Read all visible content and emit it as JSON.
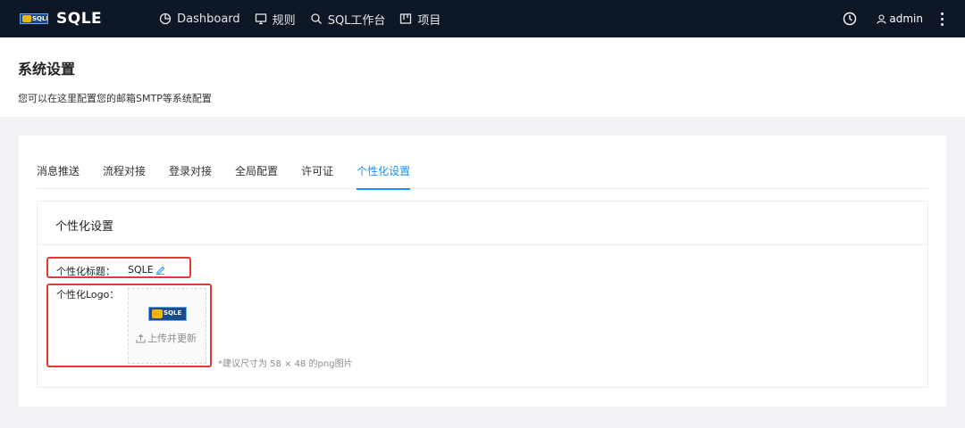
{
  "app": {
    "name": "SQLE",
    "logo_text": "SQLE"
  },
  "nav": [
    {
      "label": "Dashboard",
      "icon": "dashboard-icon"
    },
    {
      "label": "规则",
      "icon": "monitor-icon"
    },
    {
      "label": "SQL工作台",
      "icon": "search-icon"
    },
    {
      "label": "项目",
      "icon": "project-icon"
    }
  ],
  "user": {
    "name": "admin"
  },
  "page": {
    "title": "系统设置",
    "description": "您可以在这里配置您的邮箱SMTP等系统配置"
  },
  "tabs": [
    {
      "label": "消息推送",
      "active": false
    },
    {
      "label": "流程对接",
      "active": false
    },
    {
      "label": "登录对接",
      "active": false
    },
    {
      "label": "全局配置",
      "active": false
    },
    {
      "label": "许可证",
      "active": false
    },
    {
      "label": "个性化设置",
      "active": true
    }
  ],
  "personalization": {
    "section_title": "个性化设置",
    "title_label": "个性化标题：",
    "title_value": "SQLE",
    "logo_label": "个性化Logo：",
    "upload_label": "上传并更新",
    "hint": "*建议尺寸为 58 × 48 的png图片"
  },
  "colors": {
    "topbar": "#0e1726",
    "accent": "#1890ff",
    "highlight": "#e53935"
  }
}
